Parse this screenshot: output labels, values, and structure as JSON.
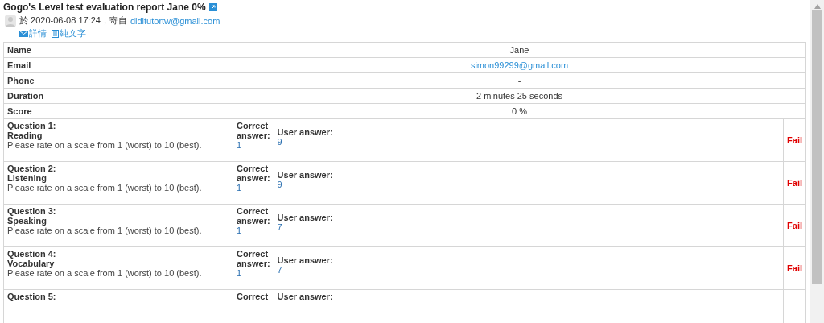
{
  "header": {
    "title": "Gogo's Level test evaluation report Jane 0%",
    "meta": "於 2020-06-08 17:24，寄自",
    "sender": "diditutortw@gmail.com",
    "links": [
      {
        "kind": "details",
        "label": "詳情"
      },
      {
        "kind": "text",
        "label": "純文字"
      }
    ]
  },
  "fields": [
    {
      "label": "Name",
      "value": "Jane",
      "kind": "text"
    },
    {
      "label": "Email",
      "value": "simon99299@gmail.com",
      "kind": "link"
    },
    {
      "label": "Phone",
      "value": "-",
      "kind": "text"
    },
    {
      "label": "Duration",
      "value": "2 minutes 25 seconds",
      "kind": "text"
    },
    {
      "label": "Score",
      "value": "0 %",
      "kind": "text"
    }
  ],
  "questions": [
    {
      "number": "Question 1:",
      "topic": "Reading",
      "prompt": "Please rate on a scale from 1 (worst) to 10 (best).",
      "correct_label": "Correct answer:",
      "correct": "1",
      "user_label": "User answer:",
      "user": "9",
      "result": "Fail"
    },
    {
      "number": "Question 2:",
      "topic": "Listening",
      "prompt": "Please rate on a scale from 1 (worst) to 10 (best).",
      "correct_label": "Correct answer:",
      "correct": "1",
      "user_label": "User answer:",
      "user": "9",
      "result": "Fail"
    },
    {
      "number": "Question 3:",
      "topic": "Speaking",
      "prompt": "Please rate on a scale from 1 (worst) to 10 (best).",
      "correct_label": "Correct answer:",
      "correct": "1",
      "user_label": "User answer:",
      "user": "7",
      "result": "Fail"
    },
    {
      "number": "Question 4:",
      "topic": "Vocabulary",
      "prompt": "Please rate on a scale from 1 (worst) to 10 (best).",
      "correct_label": "Correct answer:",
      "correct": "1",
      "user_label": "User answer:",
      "user": "7",
      "result": "Fail"
    },
    {
      "number": "Question 5:",
      "correct_label": "Correct",
      "user_label": "User answer:"
    }
  ]
}
